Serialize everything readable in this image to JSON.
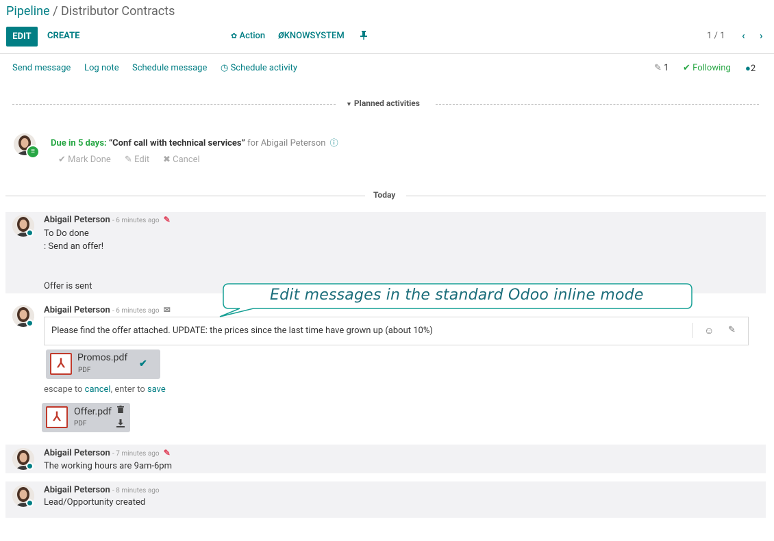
{
  "breadcrumb": {
    "parent": "Pipeline",
    "separator": " / ",
    "current": "Distributor Contracts"
  },
  "toolbar": {
    "edit_label": "EDIT",
    "create_label": "CREATE",
    "action_label": "Action",
    "knowsystem_label": "KNOWSYSTEM",
    "pager": "1 / 1"
  },
  "chatter_topbar": {
    "send_message": "Send message",
    "log_note": "Log note",
    "schedule_message": "Schedule message",
    "schedule_activity": "Schedule activity",
    "attachments_count": "1",
    "following": "Following",
    "followers_count": "2"
  },
  "planned_activities": {
    "title": "Planned activities",
    "activity": {
      "due": "Due in 5 days:",
      "summary": "“Conf call with technical services”",
      "for": "for Abigail Peterson",
      "mark_done": "Mark Done",
      "edit": "Edit",
      "cancel": "Cancel"
    }
  },
  "today_label": "Today",
  "messages": [
    {
      "author": "Abigail Peterson",
      "ago": "- 6 minutes ago",
      "lines": [
        "To Do done",
        ": Send an offer!",
        "Offer is sent"
      ]
    },
    {
      "author": "Abigail Peterson",
      "ago": "- 6 minutes ago",
      "editor_text": "Please find the offer attached.  UPDATE: the prices since the last time have grown up (about 10%)",
      "edit_attachment": {
        "name": "Promos.pdf",
        "ext": "PDF"
      },
      "hint": {
        "prefix": "escape to ",
        "cancel": "cancel",
        "middle": ", enter to ",
        "save": "save"
      },
      "attachment": {
        "name": "Offer.pdf",
        "ext": "PDF"
      }
    },
    {
      "author": "Abigail Peterson",
      "ago": "- 7 minutes ago",
      "lines": [
        "The working hours are 9am-6pm"
      ]
    },
    {
      "author": "Abigail Peterson",
      "ago": "- 8 minutes ago",
      "lines": [
        "Lead/Opportunity created"
      ]
    }
  ],
  "callout": {
    "text": "Edit messages in the standard Odoo inline mode"
  },
  "colors": {
    "accent": "#017e84",
    "success": "#28a745",
    "danger": "#e0465e",
    "pdf": "#c0392b",
    "callout": "#17a095"
  }
}
